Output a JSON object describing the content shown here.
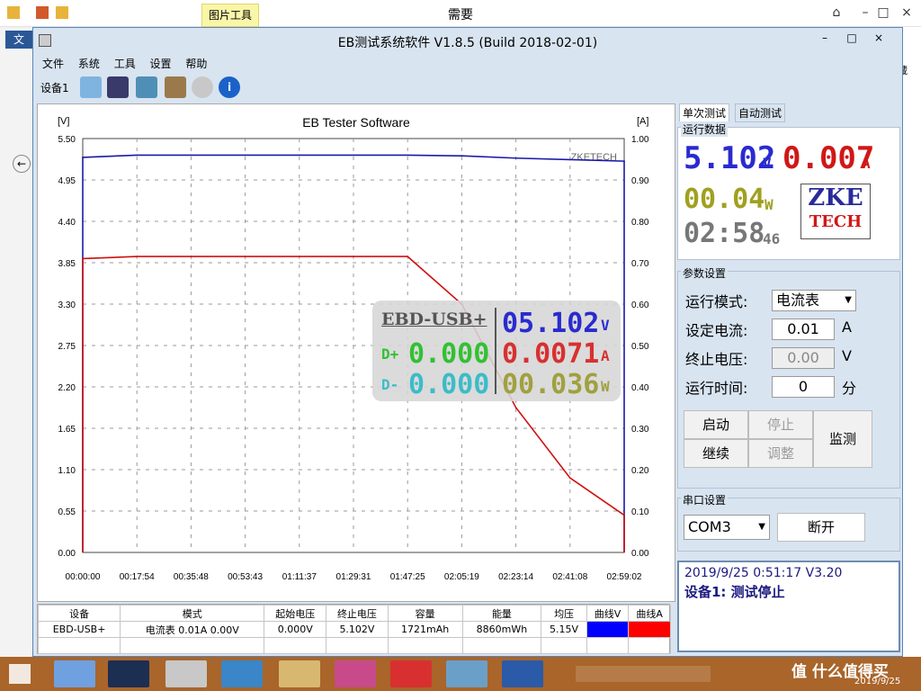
{
  "outer": {
    "title": "需要",
    "pic_tools": "图片工具",
    "left_text": "文",
    "right_text": "藏"
  },
  "app": {
    "title": "EB测试系统软件 V1.8.5 (Build 2018-02-01)",
    "menu": [
      "文件",
      "系统",
      "工具",
      "设置",
      "帮助"
    ],
    "device_label": "设备1"
  },
  "chart": {
    "title": "EB Tester Software",
    "left_unit": "[V]",
    "right_unit": "[A]",
    "watermark": "ZKETECH",
    "left_ticks": [
      "5.50",
      "4.95",
      "4.40",
      "3.85",
      "3.30",
      "2.75",
      "2.20",
      "1.65",
      "1.10",
      "0.55",
      "0.00"
    ],
    "right_ticks": [
      "1.00",
      "0.90",
      "0.80",
      "0.70",
      "0.60",
      "0.50",
      "0.40",
      "0.30",
      "0.20",
      "0.10",
      "0.00"
    ],
    "x_ticks": [
      "00:00:00",
      "00:17:54",
      "00:35:48",
      "00:53:43",
      "01:11:37",
      "01:29:31",
      "01:47:25",
      "02:05:19",
      "02:23:14",
      "02:41:08",
      "02:59:02"
    ]
  },
  "chart_data": {
    "type": "line",
    "title": "EB Tester Software",
    "xlabel": "",
    "ylabel": "[V]",
    "y2label": "[A]",
    "ylim": [
      0,
      5.5
    ],
    "y2lim": [
      0,
      1.0
    ],
    "grid": true,
    "x": [
      "00:00:00",
      "00:17:54",
      "00:35:48",
      "00:53:43",
      "01:11:37",
      "01:29:31",
      "01:47:25",
      "02:05:19",
      "02:23:14",
      "02:41:08",
      "02:59:02"
    ],
    "series": [
      {
        "name": "V",
        "color": "#1a1aa8",
        "axis": "left",
        "values": [
          5.25,
          5.28,
          5.28,
          5.28,
          5.28,
          5.28,
          5.28,
          5.27,
          5.24,
          5.22,
          5.2
        ]
      },
      {
        "name": "A",
        "color": "#d01010",
        "axis": "right",
        "values": [
          0.71,
          0.715,
          0.715,
          0.715,
          0.715,
          0.715,
          0.715,
          0.6,
          0.35,
          0.18,
          0.09
        ]
      }
    ]
  },
  "lcd": {
    "label": "EBD-USB+",
    "dp_label": "D+",
    "dp_value": "0.000",
    "dm_label": "D-",
    "dm_value": "0.000",
    "voltage": "05.102",
    "voltage_unit": "V",
    "current": "0.0071",
    "current_unit": "A",
    "power": "00.036",
    "power_unit": "W"
  },
  "right": {
    "tab_single": "单次测试",
    "tab_auto": "自动测试",
    "run_data_title": "运行数据",
    "voltage": "5.102",
    "voltage_unit": "V",
    "current": "0.007",
    "current_unit": "A",
    "power": "00.04",
    "power_unit": "W",
    "time": "02:58",
    "time_sec": "46",
    "logo_top": "ZKE",
    "logo_bottom": "TECH",
    "params_title": "参数设置",
    "mode_label": "运行模式:",
    "mode_value": "电流表",
    "set_current_label": "设定电流:",
    "set_current_value": "0.01",
    "set_current_unit": "A",
    "stop_voltage_label": "终止电压:",
    "stop_voltage_value": "0.00",
    "stop_voltage_unit": "V",
    "run_time_label": "运行时间:",
    "run_time_value": "0",
    "run_time_unit": "分",
    "btn_start": "启动",
    "btn_stop": "停止",
    "btn_continue": "继续",
    "btn_adjust": "调整",
    "btn_monitor": "监测",
    "serial_title": "串口设置",
    "com_value": "COM3",
    "btn_disconnect": "断开",
    "status_line1": "2019/9/25 0:51:17  V3.20",
    "status_line2": "设备1: 测试停止"
  },
  "table": {
    "headers": [
      "设备",
      "模式",
      "起始电压",
      "终止电压",
      "容量",
      "能量",
      "均压",
      "曲线V",
      "曲线A"
    ],
    "row": [
      "EBD-USB+",
      "电流表  0.01A  0.00V",
      "0.000V",
      "5.102V",
      "1721mAh",
      "8860mWh",
      "5.15V",
      "",
      ""
    ],
    "curve_v_color": "#0000ff",
    "curve_a_color": "#ff0000"
  },
  "taskbar": {
    "date": "2019/9/25",
    "watermark": "值 什么值得买"
  }
}
